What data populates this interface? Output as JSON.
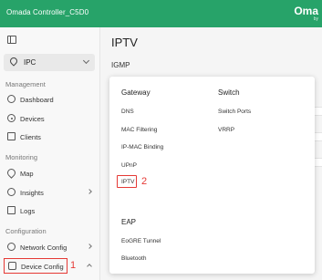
{
  "header": {
    "title": "Omada Controller_C5D0",
    "brand": "Oma",
    "brand_sub": "by"
  },
  "sidebar": {
    "site": "IPC",
    "sections": {
      "management": "Management",
      "monitoring": "Monitoring",
      "configuration": "Configuration"
    },
    "items": {
      "dashboard": "Dashboard",
      "devices": "Devices",
      "clients": "Clients",
      "map": "Map",
      "insights": "Insights",
      "logs": "Logs",
      "network_config": "Network Config",
      "device_config": "Device Config"
    }
  },
  "annotations": {
    "step1": "1",
    "step2": "2"
  },
  "main": {
    "title": "IPTV",
    "subtitle": "IGMP"
  },
  "menu": {
    "gateway": {
      "heading": "Gateway",
      "items": [
        "DNS",
        "MAC Filtering",
        "IP-MAC Binding",
        "UPnP",
        "IPTV"
      ]
    },
    "switch": {
      "heading": "Switch",
      "items": [
        "Switch Ports",
        "VRRP"
      ]
    },
    "eap": {
      "heading": "EAP",
      "items": [
        "EoGRE Tunnel",
        "Bluetooth"
      ]
    }
  },
  "colors": {
    "header_bg": "#27a369",
    "highlight": "#e53935"
  }
}
